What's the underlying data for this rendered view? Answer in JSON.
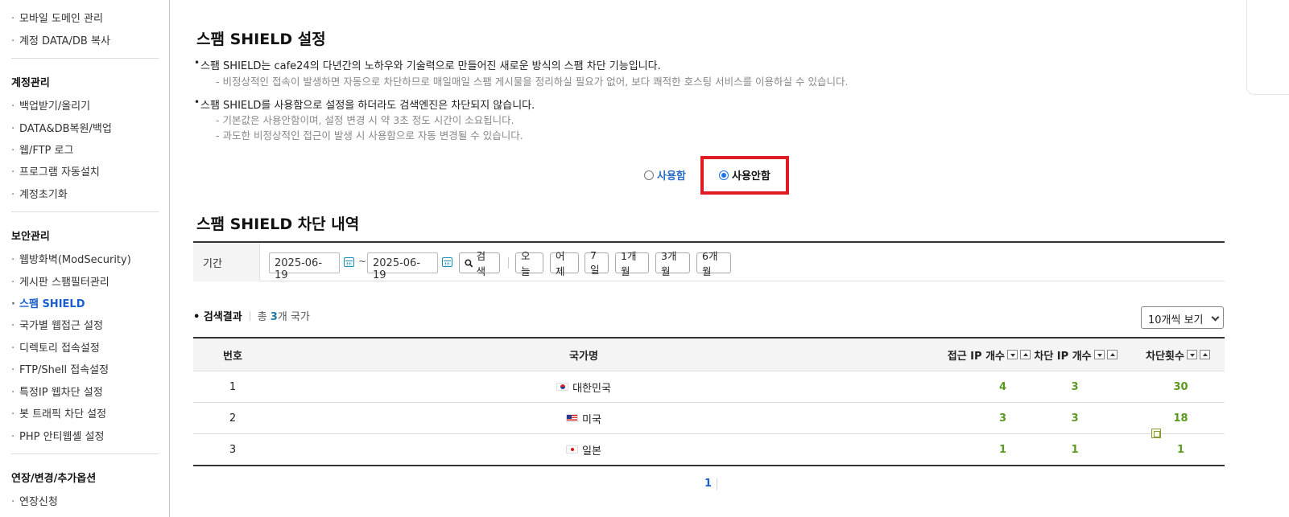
{
  "sidebar": {
    "items_top": [
      "모바일 도메인 관리",
      "계정 DATA/DB 복사"
    ],
    "sections": [
      {
        "title": "계정관리",
        "items": [
          "백업받기/올리기",
          "DATA&DB복원/백업",
          "웹/FTP 로그",
          "프로그램 자동설치",
          "계정초기화"
        ]
      },
      {
        "title": "보안관리",
        "items": [
          "웹방화벽(ModSecurity)",
          "게시판 스팸필터관리",
          "스팸 SHIELD",
          "국가별 웹접근 설정",
          "디렉토리 접속설정",
          "FTP/Shell 접속설정",
          "특정IP 웹차단 설정",
          "봇 트래픽 차단 설정",
          "PHP 안티웹셸 설정"
        ]
      },
      {
        "title": "연장/변경/추가옵션",
        "items": [
          "연장신청"
        ]
      }
    ],
    "active_item": "스팸 SHIELD"
  },
  "settings": {
    "title": "스팸 SHIELD 설정",
    "bullet1": "스팸 SHIELD는 cafe24의 다년간의 노하우와 기술력으로 만들어진 새로운 방식의 스팸 차단 기능입니다.",
    "bullet1_sub": "- 비정상적인 접속이 발생하면 자동으로 차단하므로 매일매일 스팸 게시물을 정리하실 필요가 없어, 보다 쾌적한 호스팅 서비스를 이용하실 수 있습니다.",
    "bullet2": "스팸 SHIELD를 사용함으로 설정을 하더라도 검색엔진은 차단되지 않습니다.",
    "bullet2_sub1": "- 기본값은 사용안함이며, 설정 변경 시 약 3초 정도 시간이 소요됩니다.",
    "bullet2_sub2": "- 과도한 비정상적인 접근이 발생 시 사용함으로 자동 변경될 수 있습니다.",
    "radio_on_label": "사용함",
    "radio_off_label": "사용안함",
    "selected": "사용안함"
  },
  "history": {
    "title": "스팸 SHIELD 차단 내역",
    "period_label": "기간",
    "date_from": "2025-06-19",
    "date_to": "2025-06-19",
    "tilde": "~",
    "search_label": "검색",
    "quick": [
      "오늘",
      "어제",
      "7일",
      "1개월",
      "3개월",
      "6개월"
    ],
    "result_label": "검색결과",
    "total_prefix": "총",
    "total_count": "3",
    "total_suffix": "개 국가",
    "page_size": "10개씩 보기",
    "columns": [
      "번호",
      "국가명",
      "접근 IP 개수",
      "차단 IP 개수",
      "차단횟수"
    ],
    "rows": [
      {
        "no": "1",
        "country": "대한민국",
        "access": "4",
        "blocked": "3",
        "count": "30"
      },
      {
        "no": "2",
        "country": "미국",
        "access": "3",
        "blocked": "3",
        "count": "18"
      },
      {
        "no": "3",
        "country": "일본",
        "access": "1",
        "blocked": "1",
        "count": "1"
      }
    ],
    "page": "1"
  }
}
